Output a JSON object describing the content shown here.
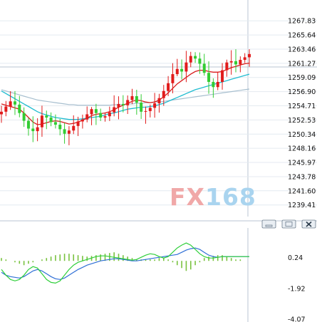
{
  "colors": {
    "background": "#ffffff",
    "bull_candle": "#e11b1b",
    "bear_candle": "#33cc33",
    "ma_short": "#d81b1b",
    "ma_mid": "#1fbcd0",
    "ma_long": "#a7bfcf",
    "macd_signal": "#2f6fd6",
    "macd_line": "#2fcf3a",
    "macd_hist": "#79c23f",
    "watermark_fx": "#f0a8a8",
    "watermark_num": "#a9d4ef"
  },
  "watermark": {
    "left": "FX",
    "right": "168"
  },
  "window_buttons": [
    "minimize-icon",
    "restore-icon",
    "close-icon"
  ],
  "chart_data": [
    {
      "type": "candlestick",
      "title": "",
      "xlabel": "",
      "ylabel": "",
      "ylim": [
        1238.5,
        1269.5
      ],
      "y_ticks": [
        "1267.83",
        "1265.64",
        "1263.46",
        "1261.27",
        "1259.09",
        "1256.90",
        "1254.71",
        "1252.53",
        "1250.34",
        "1248.16",
        "1245.97",
        "1243.78",
        "1241.60",
        "1239.41"
      ],
      "grid": true,
      "legend": "none",
      "series": [
        {
          "name": "",
          "kind": "close",
          "values": [
            1253.8,
            1254.6,
            1255.4,
            1254.9,
            1253.6,
            1252.4,
            1251.2,
            1250.8,
            1251.4,
            1253.2,
            1252.9,
            1252.2,
            1251.8,
            1251.1,
            1250.4,
            1250.9,
            1251.6,
            1252.3,
            1252.6,
            1253.4,
            1254.2,
            1253.6,
            1252.9,
            1253.1,
            1253.7,
            1254.5,
            1255.0,
            1254.8,
            1255.6,
            1256.2,
            1255.2,
            1253.8,
            1253.9,
            1254.4,
            1255.1,
            1255.9,
            1257.0,
            1258.2,
            1259.6,
            1260.4,
            1260.0,
            1261.4,
            1262.4,
            1262.0,
            1261.2,
            1259.8,
            1258.4,
            1257.6,
            1258.4,
            1260.2,
            1261.4,
            1261.6,
            1261.1,
            1261.8,
            1262.2,
            1262.7
          ]
        },
        {
          "name": "",
          "kind": "ma_short",
          "values": [
            1255.0,
            1254.8,
            1254.6,
            1254.4,
            1254.2,
            1253.6,
            1252.9,
            1252.2,
            1251.8,
            1251.9,
            1252.1,
            1252.3,
            1252.4,
            1252.3,
            1252.1,
            1251.9,
            1252.0,
            1252.2,
            1252.5,
            1252.8,
            1253.2,
            1253.4,
            1253.5,
            1253.6,
            1253.8,
            1254.1,
            1254.5,
            1254.8,
            1255.1,
            1255.4,
            1255.6,
            1255.5,
            1255.3,
            1255.2,
            1255.3,
            1255.6,
            1256.1,
            1256.7,
            1257.4,
            1258.1,
            1258.6,
            1259.1,
            1259.6,
            1260.0,
            1260.2,
            1260.2,
            1260.0,
            1259.9,
            1259.9,
            1260.0,
            1260.3,
            1260.6,
            1260.8,
            1261.0,
            1261.2,
            1261.3
          ]
        },
        {
          "name": "",
          "kind": "ma_mid",
          "values": [
            1257.0,
            1256.6,
            1256.2,
            1255.8,
            1255.4,
            1255.0,
            1254.6,
            1254.2,
            1253.8,
            1253.5,
            1253.3,
            1253.1,
            1252.9,
            1252.8,
            1252.7,
            1252.6,
            1252.6,
            1252.6,
            1252.7,
            1252.8,
            1252.9,
            1253.0,
            1253.1,
            1253.3,
            1253.5,
            1253.6,
            1253.8,
            1254.0,
            1254.2,
            1254.3,
            1254.4,
            1254.5,
            1254.5,
            1254.6,
            1254.7,
            1254.9,
            1255.1,
            1255.4,
            1255.7,
            1256.0,
            1256.3,
            1256.6,
            1256.9,
            1257.2,
            1257.4,
            1257.6,
            1257.8,
            1258.0,
            1258.2,
            1258.4,
            1258.6,
            1258.8,
            1259.0,
            1259.2,
            1259.4,
            1259.6
          ]
        },
        {
          "name": "",
          "kind": "ma_long",
          "values": [
            1257.2,
            1257.0,
            1256.8,
            1256.6,
            1256.4,
            1256.2,
            1256.0,
            1255.8,
            1255.6,
            1255.5,
            1255.4,
            1255.3,
            1255.2,
            1255.1,
            1255.0,
            1254.9,
            1254.9,
            1254.8,
            1254.8,
            1254.8,
            1254.8,
            1254.8,
            1254.8,
            1254.8,
            1254.8,
            1254.9,
            1254.9,
            1254.9,
            1255.0,
            1255.0,
            1255.1,
            1255.1,
            1255.2,
            1255.2,
            1255.3,
            1255.3,
            1255.4,
            1255.5,
            1255.6,
            1255.7,
            1255.8,
            1255.9,
            1256.0,
            1256.1,
            1256.2,
            1256.3,
            1256.4,
            1256.5,
            1256.6,
            1256.7,
            1256.8,
            1256.9,
            1257.0,
            1257.1,
            1257.2,
            1257.3
          ]
        }
      ]
    },
    {
      "type": "macd",
      "title": "",
      "xlabel": "",
      "ylabel": "",
      "ylim": [
        -4.07,
        2.2
      ],
      "y_ticks": [
        "0.24",
        "-1.92",
        "-4.07"
      ],
      "grid": false,
      "legend": "none",
      "series": [
        {
          "name": "",
          "kind": "signal",
          "values": [
            -0.8,
            -1.0,
            -1.1,
            -1.15,
            -1.2,
            -1.1,
            -0.9,
            -0.7,
            -0.6,
            -0.7,
            -0.9,
            -1.1,
            -1.25,
            -1.3,
            -1.2,
            -1.0,
            -0.8,
            -0.6,
            -0.45,
            -0.3,
            -0.2,
            -0.1,
            0.0,
            0.05,
            0.1,
            0.15,
            0.15,
            0.1,
            0.05,
            0.0,
            0.0,
            0.05,
            0.1,
            0.15,
            0.2,
            0.25,
            0.3,
            0.35,
            0.4,
            0.45,
            0.6,
            0.75,
            0.85,
            0.9,
            0.8,
            0.6,
            0.4,
            0.3,
            0.25,
            0.3,
            0.3,
            0.3,
            0.3,
            0.3,
            0.3,
            0.3
          ]
        },
        {
          "name": "",
          "kind": "macd",
          "values": [
            -0.6,
            -1.0,
            -1.3,
            -1.4,
            -1.3,
            -1.0,
            -0.6,
            -0.4,
            -0.5,
            -0.9,
            -1.3,
            -1.5,
            -1.55,
            -1.4,
            -1.0,
            -0.6,
            -0.3,
            -0.1,
            0.0,
            0.1,
            0.2,
            0.3,
            0.35,
            0.35,
            0.3,
            0.25,
            0.2,
            0.15,
            0.1,
            0.05,
            0.1,
            0.25,
            0.4,
            0.5,
            0.45,
            0.3,
            0.2,
            0.3,
            0.6,
            0.9,
            1.1,
            1.25,
            1.1,
            0.8,
            0.5,
            0.3,
            0.2,
            0.2,
            0.25,
            0.3,
            0.3,
            0.3,
            0.3,
            0.3,
            0.3,
            0.3
          ]
        },
        {
          "name": "",
          "kind": "histogram",
          "values": [
            0.2,
            0.1,
            0.0,
            -0.1,
            -0.2,
            -0.3,
            -0.2,
            -0.1,
            0.0,
            0.1,
            0.2,
            0.3,
            0.4,
            0.45,
            0.5,
            0.5,
            0.45,
            0.4,
            0.35,
            0.3,
            0.35,
            0.4,
            0.45,
            0.5,
            0.55,
            0.6,
            0.5,
            0.4,
            0.3,
            0.2,
            0.1,
            0.1,
            0.1,
            0.1,
            0.1,
            0.2,
            0.2,
            0.1,
            -0.1,
            -0.3,
            -0.5,
            -0.7,
            -0.6,
            -0.3,
            -0.1,
            0.2,
            0.3,
            0.35,
            0.4,
            0.4,
            0.3,
            0.2,
            0.1,
            0.1,
            0.0,
            0.0
          ]
        }
      ]
    }
  ]
}
